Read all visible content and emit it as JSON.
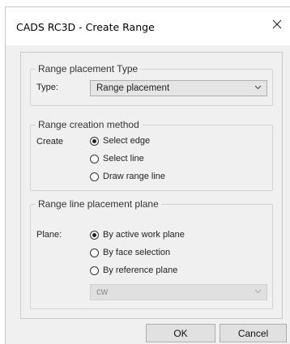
{
  "window": {
    "title": "CADS RC3D - Create Range",
    "close_label": "×"
  },
  "placement_type": {
    "legend": "Range placement Type",
    "type_label": "Type:",
    "type_value": "Range placement"
  },
  "creation_method": {
    "legend": "Range creation method",
    "create_label": "Create",
    "options": [
      "Select edge",
      "Select line",
      "Draw range line"
    ],
    "selected": "Select edge"
  },
  "placement_plane": {
    "legend": "Range line placement plane",
    "plane_label": "Plane:",
    "options": [
      "By active work plane",
      "By face selection",
      "By reference plane"
    ],
    "selected": "By active work plane",
    "reference_plane_value": "cw"
  },
  "buttons": {
    "ok": "OK",
    "cancel": "Cancel"
  },
  "icons": {
    "close": "close-icon",
    "dropdown": "chevron-down-icon"
  }
}
